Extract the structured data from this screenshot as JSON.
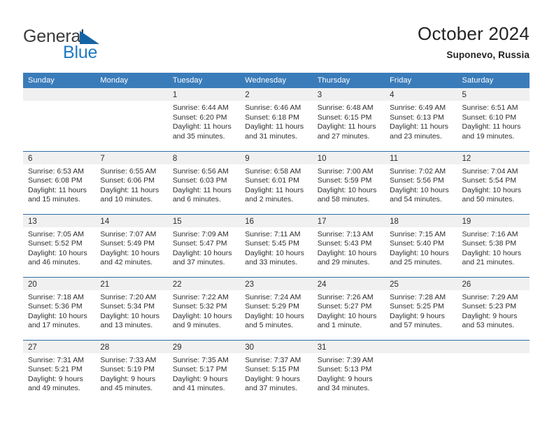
{
  "brand": {
    "name_top": "General",
    "name_bottom": "Blue",
    "triangle_color": "#1464a5",
    "blue_color": "#1f7ac4"
  },
  "header": {
    "title": "October 2024",
    "subtitle": "Suponevo, Russia"
  },
  "theme": {
    "header_row_bg": "#3a7cba",
    "row_divider": "#2e6da4",
    "day_strip_bg": "#f0f0f0"
  },
  "weekdays": [
    "Sunday",
    "Monday",
    "Tuesday",
    "Wednesday",
    "Thursday",
    "Friday",
    "Saturday"
  ],
  "weeks": [
    [
      {
        "day": "",
        "lines": []
      },
      {
        "day": "",
        "lines": []
      },
      {
        "day": "1",
        "lines": [
          "Sunrise: 6:44 AM",
          "Sunset: 6:20 PM",
          "Daylight: 11 hours",
          "and 35 minutes."
        ]
      },
      {
        "day": "2",
        "lines": [
          "Sunrise: 6:46 AM",
          "Sunset: 6:18 PM",
          "Daylight: 11 hours",
          "and 31 minutes."
        ]
      },
      {
        "day": "3",
        "lines": [
          "Sunrise: 6:48 AM",
          "Sunset: 6:15 PM",
          "Daylight: 11 hours",
          "and 27 minutes."
        ]
      },
      {
        "day": "4",
        "lines": [
          "Sunrise: 6:49 AM",
          "Sunset: 6:13 PM",
          "Daylight: 11 hours",
          "and 23 minutes."
        ]
      },
      {
        "day": "5",
        "lines": [
          "Sunrise: 6:51 AM",
          "Sunset: 6:10 PM",
          "Daylight: 11 hours",
          "and 19 minutes."
        ]
      }
    ],
    [
      {
        "day": "6",
        "lines": [
          "Sunrise: 6:53 AM",
          "Sunset: 6:08 PM",
          "Daylight: 11 hours",
          "and 15 minutes."
        ]
      },
      {
        "day": "7",
        "lines": [
          "Sunrise: 6:55 AM",
          "Sunset: 6:06 PM",
          "Daylight: 11 hours",
          "and 10 minutes."
        ]
      },
      {
        "day": "8",
        "lines": [
          "Sunrise: 6:56 AM",
          "Sunset: 6:03 PM",
          "Daylight: 11 hours",
          "and 6 minutes."
        ]
      },
      {
        "day": "9",
        "lines": [
          "Sunrise: 6:58 AM",
          "Sunset: 6:01 PM",
          "Daylight: 11 hours",
          "and 2 minutes."
        ]
      },
      {
        "day": "10",
        "lines": [
          "Sunrise: 7:00 AM",
          "Sunset: 5:59 PM",
          "Daylight: 10 hours",
          "and 58 minutes."
        ]
      },
      {
        "day": "11",
        "lines": [
          "Sunrise: 7:02 AM",
          "Sunset: 5:56 PM",
          "Daylight: 10 hours",
          "and 54 minutes."
        ]
      },
      {
        "day": "12",
        "lines": [
          "Sunrise: 7:04 AM",
          "Sunset: 5:54 PM",
          "Daylight: 10 hours",
          "and 50 minutes."
        ]
      }
    ],
    [
      {
        "day": "13",
        "lines": [
          "Sunrise: 7:05 AM",
          "Sunset: 5:52 PM",
          "Daylight: 10 hours",
          "and 46 minutes."
        ]
      },
      {
        "day": "14",
        "lines": [
          "Sunrise: 7:07 AM",
          "Sunset: 5:49 PM",
          "Daylight: 10 hours",
          "and 42 minutes."
        ]
      },
      {
        "day": "15",
        "lines": [
          "Sunrise: 7:09 AM",
          "Sunset: 5:47 PM",
          "Daylight: 10 hours",
          "and 37 minutes."
        ]
      },
      {
        "day": "16",
        "lines": [
          "Sunrise: 7:11 AM",
          "Sunset: 5:45 PM",
          "Daylight: 10 hours",
          "and 33 minutes."
        ]
      },
      {
        "day": "17",
        "lines": [
          "Sunrise: 7:13 AM",
          "Sunset: 5:43 PM",
          "Daylight: 10 hours",
          "and 29 minutes."
        ]
      },
      {
        "day": "18",
        "lines": [
          "Sunrise: 7:15 AM",
          "Sunset: 5:40 PM",
          "Daylight: 10 hours",
          "and 25 minutes."
        ]
      },
      {
        "day": "19",
        "lines": [
          "Sunrise: 7:16 AM",
          "Sunset: 5:38 PM",
          "Daylight: 10 hours",
          "and 21 minutes."
        ]
      }
    ],
    [
      {
        "day": "20",
        "lines": [
          "Sunrise: 7:18 AM",
          "Sunset: 5:36 PM",
          "Daylight: 10 hours",
          "and 17 minutes."
        ]
      },
      {
        "day": "21",
        "lines": [
          "Sunrise: 7:20 AM",
          "Sunset: 5:34 PM",
          "Daylight: 10 hours",
          "and 13 minutes."
        ]
      },
      {
        "day": "22",
        "lines": [
          "Sunrise: 7:22 AM",
          "Sunset: 5:32 PM",
          "Daylight: 10 hours",
          "and 9 minutes."
        ]
      },
      {
        "day": "23",
        "lines": [
          "Sunrise: 7:24 AM",
          "Sunset: 5:29 PM",
          "Daylight: 10 hours",
          "and 5 minutes."
        ]
      },
      {
        "day": "24",
        "lines": [
          "Sunrise: 7:26 AM",
          "Sunset: 5:27 PM",
          "Daylight: 10 hours",
          "and 1 minute."
        ]
      },
      {
        "day": "25",
        "lines": [
          "Sunrise: 7:28 AM",
          "Sunset: 5:25 PM",
          "Daylight: 9 hours",
          "and 57 minutes."
        ]
      },
      {
        "day": "26",
        "lines": [
          "Sunrise: 7:29 AM",
          "Sunset: 5:23 PM",
          "Daylight: 9 hours",
          "and 53 minutes."
        ]
      }
    ],
    [
      {
        "day": "27",
        "lines": [
          "Sunrise: 7:31 AM",
          "Sunset: 5:21 PM",
          "Daylight: 9 hours",
          "and 49 minutes."
        ]
      },
      {
        "day": "28",
        "lines": [
          "Sunrise: 7:33 AM",
          "Sunset: 5:19 PM",
          "Daylight: 9 hours",
          "and 45 minutes."
        ]
      },
      {
        "day": "29",
        "lines": [
          "Sunrise: 7:35 AM",
          "Sunset: 5:17 PM",
          "Daylight: 9 hours",
          "and 41 minutes."
        ]
      },
      {
        "day": "30",
        "lines": [
          "Sunrise: 7:37 AM",
          "Sunset: 5:15 PM",
          "Daylight: 9 hours",
          "and 37 minutes."
        ]
      },
      {
        "day": "31",
        "lines": [
          "Sunrise: 7:39 AM",
          "Sunset: 5:13 PM",
          "Daylight: 9 hours",
          "and 34 minutes."
        ]
      },
      {
        "day": "",
        "lines": []
      },
      {
        "day": "",
        "lines": []
      }
    ]
  ]
}
